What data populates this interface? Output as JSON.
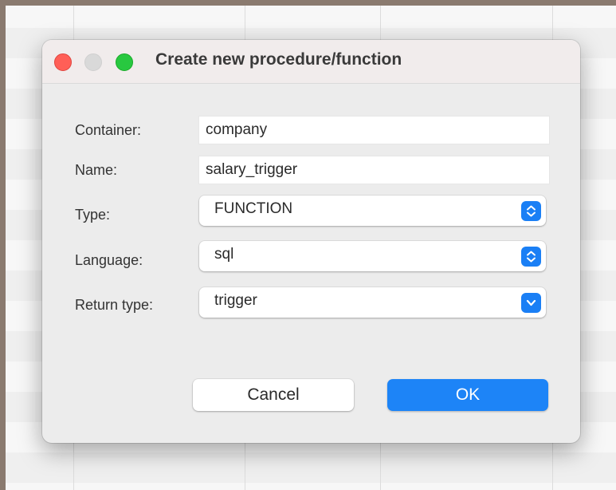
{
  "dialog": {
    "title": "Create new procedure/function"
  },
  "form": {
    "container": {
      "label": "Container:",
      "value": "company"
    },
    "name": {
      "label": "Name:",
      "value": "salary_trigger"
    },
    "type": {
      "label": "Type:",
      "value": "FUNCTION",
      "icon": "up-down-chevron-icon"
    },
    "language": {
      "label": "Language:",
      "value": "sql",
      "icon": "up-down-chevron-icon"
    },
    "return_type": {
      "label": "Return type:",
      "value": "trigger",
      "icon": "chevron-down-icon"
    }
  },
  "buttons": {
    "cancel": "Cancel",
    "ok": "OK"
  },
  "colors": {
    "accent": "#1d84f7",
    "close": "#ff5f57",
    "minimize": "#d9d9d9",
    "maximize": "#28c840"
  }
}
